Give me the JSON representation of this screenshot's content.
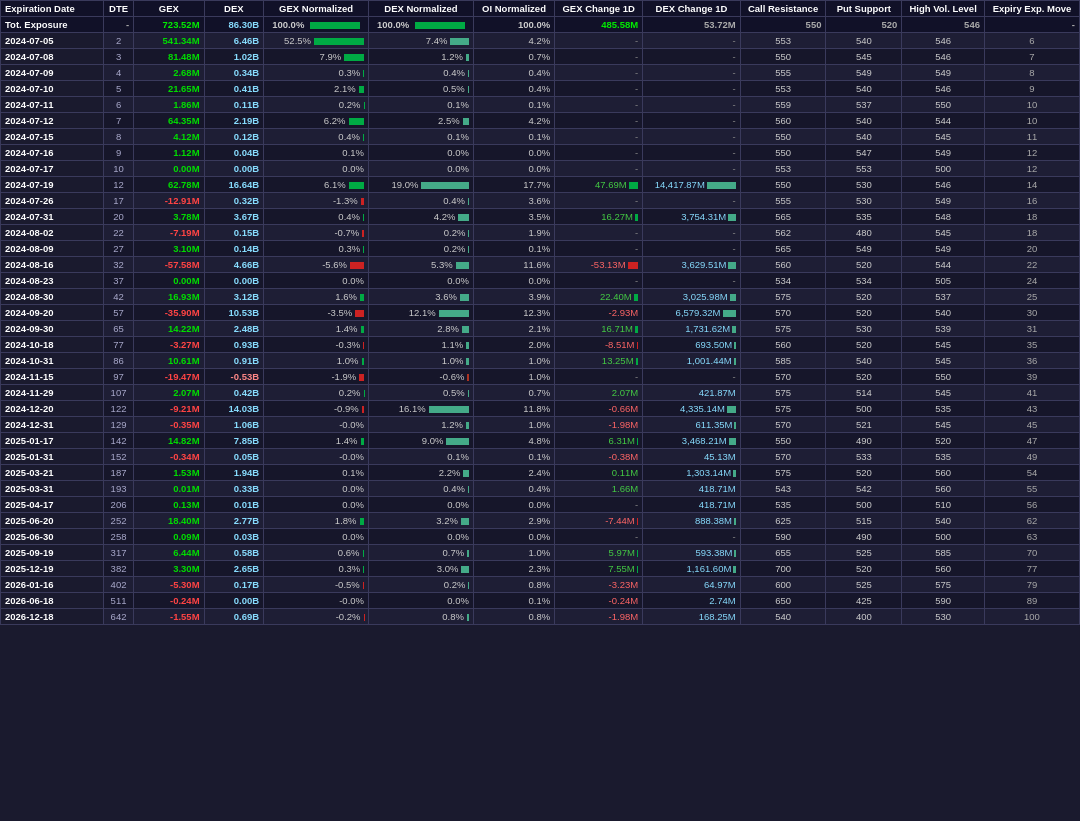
{
  "columns": [
    "Expiration Date",
    "DTE",
    "GEX",
    "DEX",
    "GEX Normalized",
    "DEX Normalized",
    "OI Normalized",
    "GEX Change 1D",
    "DEX Change 1D",
    "Call Resistance",
    "Put Support",
    "High Vol. Level",
    "Expiry Exp. Move"
  ],
  "tot_row": {
    "label": "Tot. Exposure",
    "dte": "-",
    "gex": "723.52M",
    "dex": "86.30B",
    "gex_norm": "100.0%",
    "dex_norm": "100.0%",
    "oi_norm": "100.0%",
    "gex_change": "485.58M",
    "dex_change": "53.72M",
    "call_res": "550",
    "put_sup": "520",
    "high_vol": "546",
    "expiry_move": "-"
  },
  "rows": [
    {
      "date": "2024-07-05",
      "dte": 2,
      "gex": "541.34M",
      "dex": "6.46B",
      "gex_norm": "52.5%",
      "dex_norm": "7.4%",
      "oi_norm": "4.2%",
      "gex_change": "",
      "gex_change_val": null,
      "dex_change": "",
      "call_res": "553",
      "put_sup": "540",
      "high_vol": "546",
      "expiry_move": "6",
      "gex_pos": true,
      "dex_pos": true,
      "bar_gex": 52,
      "bar_dex": 7,
      "gex_change_bar": 0,
      "dex_change_bar": 0
    },
    {
      "date": "2024-07-08",
      "dte": 3,
      "gex": "81.48M",
      "dex": "1.02B",
      "gex_norm": "7.9%",
      "dex_norm": "1.2%",
      "oi_norm": "0.7%",
      "gex_change": "-",
      "dex_change": "-",
      "call_res": "550",
      "put_sup": "545",
      "high_vol": "546",
      "expiry_move": "7",
      "gex_pos": true,
      "dex_pos": true,
      "bar_gex": 8,
      "bar_dex": 1,
      "gex_change_bar": 0,
      "dex_change_bar": 0
    },
    {
      "date": "2024-07-09",
      "dte": 4,
      "gex": "2.68M",
      "dex": "0.34B",
      "gex_norm": "0.3%",
      "dex_norm": "0.4%",
      "oi_norm": "0.4%",
      "gex_change": "-",
      "dex_change": "-",
      "call_res": "555",
      "put_sup": "549",
      "high_vol": "549",
      "expiry_move": "8",
      "gex_pos": true,
      "dex_pos": true,
      "bar_gex": 1,
      "bar_dex": 1,
      "gex_change_bar": 0,
      "dex_change_bar": 0
    },
    {
      "date": "2024-07-10",
      "dte": 5,
      "gex": "21.65M",
      "dex": "0.41B",
      "gex_norm": "2.1%",
      "dex_norm": "0.5%",
      "oi_norm": "0.4%",
      "gex_change": "-",
      "dex_change": "-",
      "call_res": "553",
      "put_sup": "540",
      "high_vol": "546",
      "expiry_move": "9",
      "gex_pos": true,
      "dex_pos": true,
      "bar_gex": 2,
      "bar_dex": 1,
      "gex_change_bar": 0,
      "dex_change_bar": 0
    },
    {
      "date": "2024-07-11",
      "dte": 6,
      "gex": "1.86M",
      "dex": "0.11B",
      "gex_norm": "0.2%",
      "dex_norm": "0.1%",
      "oi_norm": "0.1%",
      "gex_change": "-",
      "dex_change": "-",
      "call_res": "559",
      "put_sup": "537",
      "high_vol": "550",
      "expiry_move": "10",
      "gex_pos": true,
      "dex_pos": true,
      "bar_gex": 1,
      "bar_dex": 1,
      "gex_change_bar": 0,
      "dex_change_bar": 0
    },
    {
      "date": "2024-07-12",
      "dte": 7,
      "gex": "64.35M",
      "dex": "2.19B",
      "gex_norm": "6.2%",
      "dex_norm": "2.5%",
      "oi_norm": "4.2%",
      "gex_change": "-",
      "dex_change": "-",
      "call_res": "560",
      "put_sup": "540",
      "high_vol": "544",
      "expiry_move": "10",
      "gex_pos": true,
      "dex_pos": true,
      "bar_gex": 6,
      "bar_dex": 3,
      "gex_change_bar": 0,
      "dex_change_bar": 0
    },
    {
      "date": "2024-07-15",
      "dte": 8,
      "gex": "4.12M",
      "dex": "0.12B",
      "gex_norm": "0.4%",
      "dex_norm": "0.1%",
      "oi_norm": "0.1%",
      "gex_change": "-",
      "dex_change": "-",
      "call_res": "550",
      "put_sup": "540",
      "high_vol": "545",
      "expiry_move": "11",
      "gex_pos": true,
      "dex_pos": true,
      "bar_gex": 1,
      "bar_dex": 1,
      "gex_change_bar": 0,
      "dex_change_bar": 0
    },
    {
      "date": "2024-07-16",
      "dte": 9,
      "gex": "1.12M",
      "dex": "0.04B",
      "gex_norm": "0.1%",
      "dex_norm": "0.0%",
      "oi_norm": "0.0%",
      "gex_change": "-",
      "dex_change": "-",
      "call_res": "550",
      "put_sup": "547",
      "high_vol": "549",
      "expiry_move": "12",
      "gex_pos": true,
      "dex_pos": true,
      "bar_gex": 1,
      "bar_dex": 0,
      "gex_change_bar": 0,
      "dex_change_bar": 0
    },
    {
      "date": "2024-07-17",
      "dte": 10,
      "gex": "0.00M",
      "dex": "0.00B",
      "gex_norm": "0.0%",
      "dex_norm": "0.0%",
      "oi_norm": "0.0%",
      "gex_change": "-",
      "dex_change": "-",
      "call_res": "553",
      "put_sup": "553",
      "high_vol": "500",
      "expiry_move": "12",
      "gex_pos": true,
      "dex_pos": true,
      "bar_gex": 0,
      "bar_dex": 0,
      "gex_change_bar": 0,
      "dex_change_bar": 0
    },
    {
      "date": "2024-07-19",
      "dte": 12,
      "gex": "62.78M",
      "dex": "16.64B",
      "gex_norm": "6.1%",
      "dex_norm": "19.0%",
      "oi_norm": "17.7%",
      "gex_change": "47.69M",
      "dex_change": "14,417.87M",
      "call_res": "550",
      "put_sup": "530",
      "high_vol": "546",
      "expiry_move": "14",
      "gex_pos": true,
      "dex_pos": true,
      "bar_gex": 6,
      "bar_dex": 19,
      "gex_change_bar": 5,
      "dex_change_bar": 14
    },
    {
      "date": "2024-07-26",
      "dte": 17,
      "gex": "-12.91M",
      "dex": "0.32B",
      "gex_norm": "-1.3%",
      "dex_norm": "0.4%",
      "oi_norm": "3.6%",
      "gex_change": "-",
      "dex_change": "-",
      "call_res": "555",
      "put_sup": "530",
      "high_vol": "549",
      "expiry_move": "16",
      "gex_pos": false,
      "dex_pos": true,
      "bar_gex": 1,
      "bar_dex": 1,
      "gex_change_bar": 0,
      "dex_change_bar": 0
    },
    {
      "date": "2024-07-31",
      "dte": 20,
      "gex": "3.78M",
      "dex": "3.67B",
      "gex_norm": "0.4%",
      "dex_norm": "4.2%",
      "oi_norm": "3.5%",
      "gex_change": "16.27M",
      "dex_change": "3,754.31M",
      "call_res": "565",
      "put_sup": "535",
      "high_vol": "548",
      "expiry_move": "18",
      "gex_pos": true,
      "dex_pos": true,
      "bar_gex": 1,
      "bar_dex": 4,
      "gex_change_bar": 2,
      "dex_change_bar": 4
    },
    {
      "date": "2024-08-02",
      "dte": 22,
      "gex": "-7.19M",
      "dex": "0.15B",
      "gex_norm": "-0.7%",
      "dex_norm": "0.2%",
      "oi_norm": "1.9%",
      "gex_change": "-",
      "dex_change": "-",
      "call_res": "562",
      "put_sup": "480",
      "high_vol": "545",
      "expiry_move": "18",
      "gex_pos": false,
      "dex_pos": true,
      "bar_gex": 1,
      "bar_dex": 1,
      "gex_change_bar": 0,
      "dex_change_bar": 0
    },
    {
      "date": "2024-08-09",
      "dte": 27,
      "gex": "3.10M",
      "dex": "0.14B",
      "gex_norm": "0.3%",
      "dex_norm": "0.2%",
      "oi_norm": "0.1%",
      "gex_change": "-",
      "dex_change": "-",
      "call_res": "565",
      "put_sup": "549",
      "high_vol": "549",
      "expiry_move": "20",
      "gex_pos": true,
      "dex_pos": true,
      "bar_gex": 1,
      "bar_dex": 1,
      "gex_change_bar": 0,
      "dex_change_bar": 0
    },
    {
      "date": "2024-08-16",
      "dte": 32,
      "gex": "-57.58M",
      "dex": "4.66B",
      "gex_norm": "-5.6%",
      "dex_norm": "5.3%",
      "oi_norm": "11.6%",
      "gex_change": "-53.13M",
      "dex_change": "3,629.51M",
      "call_res": "560",
      "put_sup": "520",
      "high_vol": "544",
      "expiry_move": "22",
      "gex_pos": false,
      "dex_pos": true,
      "bar_gex": 6,
      "bar_dex": 5,
      "gex_change_bar": 5,
      "dex_change_bar": 4
    },
    {
      "date": "2024-08-23",
      "dte": 37,
      "gex": "0.00M",
      "dex": "0.00B",
      "gex_norm": "0.0%",
      "dex_norm": "0.0%",
      "oi_norm": "0.0%",
      "gex_change": "-",
      "dex_change": "-",
      "call_res": "534",
      "put_sup": "534",
      "high_vol": "505",
      "expiry_move": "24",
      "gex_pos": true,
      "dex_pos": true,
      "bar_gex": 0,
      "bar_dex": 0,
      "gex_change_bar": 0,
      "dex_change_bar": 0
    },
    {
      "date": "2024-08-30",
      "dte": 42,
      "gex": "16.93M",
      "dex": "3.12B",
      "gex_norm": "1.6%",
      "dex_norm": "3.6%",
      "oi_norm": "3.9%",
      "gex_change": "22.40M",
      "dex_change": "3,025.98M",
      "call_res": "575",
      "put_sup": "520",
      "high_vol": "537",
      "expiry_move": "25",
      "gex_pos": true,
      "dex_pos": true,
      "bar_gex": 2,
      "bar_dex": 4,
      "gex_change_bar": 2,
      "dex_change_bar": 3
    },
    {
      "date": "2024-09-20",
      "dte": 57,
      "gex": "-35.90M",
      "dex": "10.53B",
      "gex_norm": "-3.5%",
      "dex_norm": "12.1%",
      "oi_norm": "12.3%",
      "gex_change": "-2.93M",
      "dex_change": "6,579.32M",
      "call_res": "570",
      "put_sup": "520",
      "high_vol": "540",
      "expiry_move": "30",
      "gex_pos": false,
      "dex_pos": true,
      "bar_gex": 4,
      "bar_dex": 12,
      "gex_change_bar": 0,
      "dex_change_bar": 7
    },
    {
      "date": "2024-09-30",
      "dte": 65,
      "gex": "14.22M",
      "dex": "2.48B",
      "gex_norm": "1.4%",
      "dex_norm": "2.8%",
      "oi_norm": "2.1%",
      "gex_change": "16.71M",
      "dex_change": "1,731.62M",
      "call_res": "575",
      "put_sup": "530",
      "high_vol": "539",
      "expiry_move": "31",
      "gex_pos": true,
      "dex_pos": true,
      "bar_gex": 1,
      "bar_dex": 3,
      "gex_change_bar": 2,
      "dex_change_bar": 2
    },
    {
      "date": "2024-10-18",
      "dte": 77,
      "gex": "-3.27M",
      "dex": "0.93B",
      "gex_norm": "-0.3%",
      "dex_norm": "1.1%",
      "oi_norm": "2.0%",
      "gex_change": "-8.51M",
      "dex_change": "693.50M",
      "call_res": "560",
      "put_sup": "520",
      "high_vol": "545",
      "expiry_move": "35",
      "gex_pos": false,
      "dex_pos": true,
      "bar_gex": 0,
      "bar_dex": 1,
      "gex_change_bar": 1,
      "dex_change_bar": 1
    },
    {
      "date": "2024-10-31",
      "dte": 86,
      "gex": "10.61M",
      "dex": "0.91B",
      "gex_norm": "1.0%",
      "dex_norm": "1.0%",
      "oi_norm": "1.0%",
      "gex_change": "13.25M",
      "dex_change": "1,001.44M",
      "call_res": "585",
      "put_sup": "540",
      "high_vol": "545",
      "expiry_move": "36",
      "gex_pos": true,
      "dex_pos": true,
      "bar_gex": 1,
      "bar_dex": 1,
      "gex_change_bar": 1,
      "dex_change_bar": 1
    },
    {
      "date": "2024-11-15",
      "dte": 97,
      "gex": "-19.47M",
      "dex": "-0.53B",
      "gex_norm": "-1.9%",
      "dex_norm": "-0.6%",
      "oi_norm": "1.0%",
      "gex_change": "-",
      "dex_change": "-",
      "call_res": "570",
      "put_sup": "520",
      "high_vol": "550",
      "expiry_move": "39",
      "gex_pos": false,
      "dex_pos": false,
      "bar_gex": 2,
      "bar_dex": 1,
      "gex_change_bar": 0,
      "dex_change_bar": 0
    },
    {
      "date": "2024-11-29",
      "dte": 107,
      "gex": "2.07M",
      "dex": "0.42B",
      "gex_norm": "0.2%",
      "dex_norm": "0.5%",
      "oi_norm": "0.7%",
      "gex_change": "2.07M",
      "dex_change": "421.87M",
      "call_res": "575",
      "put_sup": "514",
      "high_vol": "545",
      "expiry_move": "41",
      "gex_pos": true,
      "dex_pos": true,
      "bar_gex": 0,
      "bar_dex": 1,
      "gex_change_bar": 0,
      "dex_change_bar": 0
    },
    {
      "date": "2024-12-20",
      "dte": 122,
      "gex": "-9.21M",
      "dex": "14.03B",
      "gex_norm": "-0.9%",
      "dex_norm": "16.1%",
      "oi_norm": "11.8%",
      "gex_change": "-0.66M",
      "dex_change": "4,335.14M",
      "call_res": "575",
      "put_sup": "500",
      "high_vol": "535",
      "expiry_move": "43",
      "gex_pos": false,
      "dex_pos": true,
      "bar_gex": 1,
      "bar_dex": 16,
      "gex_change_bar": 0,
      "dex_change_bar": 4
    },
    {
      "date": "2024-12-31",
      "dte": 129,
      "gex": "-0.35M",
      "dex": "1.06B",
      "gex_norm": "-0.0%",
      "dex_norm": "1.2%",
      "oi_norm": "1.0%",
      "gex_change": "-1.98M",
      "dex_change": "611.35M",
      "call_res": "570",
      "put_sup": "521",
      "high_vol": "545",
      "expiry_move": "45",
      "gex_pos": false,
      "dex_pos": true,
      "bar_gex": 0,
      "bar_dex": 1,
      "gex_change_bar": 0,
      "dex_change_bar": 1
    },
    {
      "date": "2025-01-17",
      "dte": 142,
      "gex": "14.82M",
      "dex": "7.85B",
      "gex_norm": "1.4%",
      "dex_norm": "9.0%",
      "oi_norm": "4.8%",
      "gex_change": "6.31M",
      "dex_change": "3,468.21M",
      "call_res": "550",
      "put_sup": "490",
      "high_vol": "520",
      "expiry_move": "47",
      "gex_pos": true,
      "dex_pos": true,
      "bar_gex": 1,
      "bar_dex": 9,
      "gex_change_bar": 1,
      "dex_change_bar": 3
    },
    {
      "date": "2025-01-31",
      "dte": 152,
      "gex": "-0.34M",
      "dex": "0.05B",
      "gex_norm": "-0.0%",
      "dex_norm": "0.1%",
      "oi_norm": "0.1%",
      "gex_change": "-0.38M",
      "dex_change": "45.13M",
      "call_res": "570",
      "put_sup": "533",
      "high_vol": "535",
      "expiry_move": "49",
      "gex_pos": false,
      "dex_pos": true,
      "bar_gex": 0,
      "bar_dex": 0,
      "gex_change_bar": 0,
      "dex_change_bar": 0
    },
    {
      "date": "2025-03-21",
      "dte": 187,
      "gex": "1.53M",
      "dex": "1.94B",
      "gex_norm": "0.1%",
      "dex_norm": "2.2%",
      "oi_norm": "2.4%",
      "gex_change": "0.11M",
      "dex_change": "1,303.14M",
      "call_res": "575",
      "put_sup": "520",
      "high_vol": "560",
      "expiry_move": "54",
      "gex_pos": true,
      "dex_pos": true,
      "bar_gex": 0,
      "bar_dex": 2,
      "gex_change_bar": 0,
      "dex_change_bar": 1
    },
    {
      "date": "2025-03-31",
      "dte": 193,
      "gex": "0.01M",
      "dex": "0.33B",
      "gex_norm": "0.0%",
      "dex_norm": "0.4%",
      "oi_norm": "0.4%",
      "gex_change": "1.66M",
      "dex_change": "418.71M",
      "call_res": "543",
      "put_sup": "542",
      "high_vol": "560",
      "expiry_move": "55",
      "gex_pos": true,
      "dex_pos": true,
      "bar_gex": 0,
      "bar_dex": 0,
      "gex_change_bar": 0,
      "dex_change_bar": 0
    },
    {
      "date": "2025-04-17",
      "dte": 206,
      "gex": "0.13M",
      "dex": "0.01B",
      "gex_norm": "0.0%",
      "dex_norm": "0.0%",
      "oi_norm": "0.0%",
      "gex_change": "-",
      "dex_change": "418.71M",
      "call_res": "535",
      "put_sup": "500",
      "high_vol": "510",
      "expiry_move": "56",
      "gex_pos": true,
      "dex_pos": true,
      "bar_gex": 0,
      "bar_dex": 0,
      "gex_change_bar": 0,
      "dex_change_bar": 0
    },
    {
      "date": "2025-06-20",
      "dte": 252,
      "gex": "18.40M",
      "dex": "2.77B",
      "gex_norm": "1.8%",
      "dex_norm": "3.2%",
      "oi_norm": "2.9%",
      "gex_change": "-7.44M",
      "dex_change": "888.38M",
      "call_res": "625",
      "put_sup": "515",
      "high_vol": "540",
      "expiry_move": "62",
      "gex_pos": true,
      "dex_pos": true,
      "bar_gex": 2,
      "bar_dex": 3,
      "gex_change_bar": 1,
      "dex_change_bar": 1
    },
    {
      "date": "2025-06-30",
      "dte": 258,
      "gex": "0.09M",
      "dex": "0.03B",
      "gex_norm": "0.0%",
      "dex_norm": "0.0%",
      "oi_norm": "0.0%",
      "gex_change": "-",
      "dex_change": "-",
      "call_res": "590",
      "put_sup": "490",
      "high_vol": "500",
      "expiry_move": "63",
      "gex_pos": true,
      "dex_pos": true,
      "bar_gex": 0,
      "bar_dex": 0,
      "gex_change_bar": 0,
      "dex_change_bar": 0
    },
    {
      "date": "2025-09-19",
      "dte": 317,
      "gex": "6.44M",
      "dex": "0.58B",
      "gex_norm": "0.6%",
      "dex_norm": "0.7%",
      "oi_norm": "1.0%",
      "gex_change": "5.97M",
      "dex_change": "593.38M",
      "call_res": "655",
      "put_sup": "525",
      "high_vol": "585",
      "expiry_move": "70",
      "gex_pos": true,
      "dex_pos": true,
      "bar_gex": 1,
      "bar_dex": 1,
      "gex_change_bar": 1,
      "dex_change_bar": 1
    },
    {
      "date": "2025-12-19",
      "dte": 382,
      "gex": "3.30M",
      "dex": "2.65B",
      "gex_norm": "0.3%",
      "dex_norm": "3.0%",
      "oi_norm": "2.3%",
      "gex_change": "7.55M",
      "dex_change": "1,161.60M",
      "call_res": "700",
      "put_sup": "520",
      "high_vol": "560",
      "expiry_move": "77",
      "gex_pos": true,
      "dex_pos": true,
      "bar_gex": 0,
      "bar_dex": 3,
      "gex_change_bar": 1,
      "dex_change_bar": 1
    },
    {
      "date": "2026-01-16",
      "dte": 402,
      "gex": "-5.30M",
      "dex": "0.17B",
      "gex_norm": "-0.5%",
      "dex_norm": "0.2%",
      "oi_norm": "0.8%",
      "gex_change": "-3.23M",
      "dex_change": "64.97M",
      "call_res": "600",
      "put_sup": "525",
      "high_vol": "575",
      "expiry_move": "79",
      "gex_pos": false,
      "dex_pos": true,
      "bar_gex": 1,
      "bar_dex": 0,
      "gex_change_bar": 0,
      "dex_change_bar": 0
    },
    {
      "date": "2026-06-18",
      "dte": 511,
      "gex": "-0.24M",
      "dex": "0.00B",
      "gex_norm": "-0.0%",
      "dex_norm": "0.0%",
      "oi_norm": "0.1%",
      "gex_change": "-0.24M",
      "dex_change": "2.74M",
      "call_res": "650",
      "put_sup": "425",
      "high_vol": "590",
      "expiry_move": "89",
      "gex_pos": false,
      "dex_pos": true,
      "bar_gex": 0,
      "bar_dex": 0,
      "gex_change_bar": 0,
      "dex_change_bar": 0
    },
    {
      "date": "2026-12-18",
      "dte": 642,
      "gex": "-1.55M",
      "dex": "0.69B",
      "gex_norm": "-0.2%",
      "dex_norm": "0.8%",
      "oi_norm": "0.8%",
      "gex_change": "-1.98M",
      "dex_change": "168.25M",
      "call_res": "540",
      "put_sup": "400",
      "high_vol": "530",
      "expiry_move": "100",
      "gex_pos": false,
      "dex_pos": true,
      "bar_gex": 0,
      "bar_dex": 1,
      "gex_change_bar": 0,
      "dex_change_bar": 0
    }
  ]
}
